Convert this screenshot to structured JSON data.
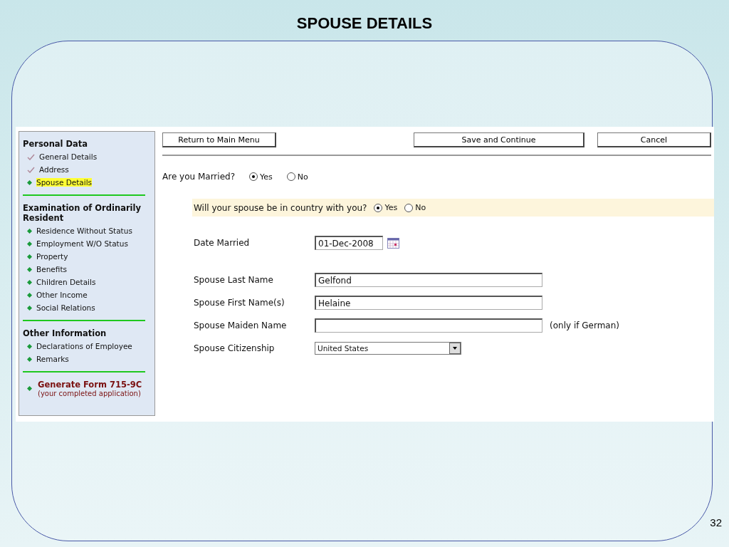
{
  "slide": {
    "title": "SPOUSE DETAILS",
    "page_number": "32"
  },
  "sidebar": {
    "sections": [
      {
        "heading": "Personal Data",
        "items": [
          {
            "label": "General Details",
            "kind": "done",
            "selected": false
          },
          {
            "label": "Address",
            "kind": "done",
            "selected": false
          },
          {
            "label": "Spouse Details",
            "kind": "bullet",
            "selected": true
          }
        ]
      },
      {
        "heading": "Examination of Ordinarily Resident",
        "items": [
          {
            "label": "Residence Without Status",
            "kind": "bullet",
            "selected": false
          },
          {
            "label": "Employment W/O Status",
            "kind": "bullet",
            "selected": false
          },
          {
            "label": "Property",
            "kind": "bullet",
            "selected": false
          },
          {
            "label": "Benefits",
            "kind": "bullet",
            "selected": false
          },
          {
            "label": "Children Details",
            "kind": "bullet",
            "selected": false
          },
          {
            "label": "Other Income",
            "kind": "bullet",
            "selected": false
          },
          {
            "label": "Social Relations",
            "kind": "bullet",
            "selected": false
          }
        ]
      },
      {
        "heading": "Other Information",
        "items": [
          {
            "label": "Declarations of Employee",
            "kind": "bullet",
            "selected": false
          },
          {
            "label": "Remarks",
            "kind": "bullet",
            "selected": false
          }
        ]
      }
    ],
    "generate": {
      "label": "Generate Form 715-9C",
      "note": "(your completed application)"
    }
  },
  "toolbar": {
    "left": "Return to Main Menu",
    "right": [
      "Save and Continue",
      "Cancel"
    ]
  },
  "married": {
    "question": "Are you Married?",
    "options": [
      {
        "label": "Yes",
        "selected": true
      },
      {
        "label": "No",
        "selected": false
      }
    ]
  },
  "in_country": {
    "question": "Will your spouse be in country with you?",
    "options": [
      {
        "label": "Yes",
        "selected": true
      },
      {
        "label": "No",
        "selected": false
      }
    ]
  },
  "date_married": {
    "label": "Date Married",
    "value": "01-Dec-2008"
  },
  "fields": [
    {
      "kind": "text",
      "label": "Spouse Last Name",
      "value": "Gelfond"
    },
    {
      "kind": "text",
      "label": "Spouse First Name(s)",
      "value": "Helaine"
    },
    {
      "kind": "text",
      "label": "Spouse Maiden Name",
      "note": "(only if German)"
    },
    {
      "kind": "select",
      "label": "Spouse Citizenship",
      "value": "United States"
    }
  ]
}
